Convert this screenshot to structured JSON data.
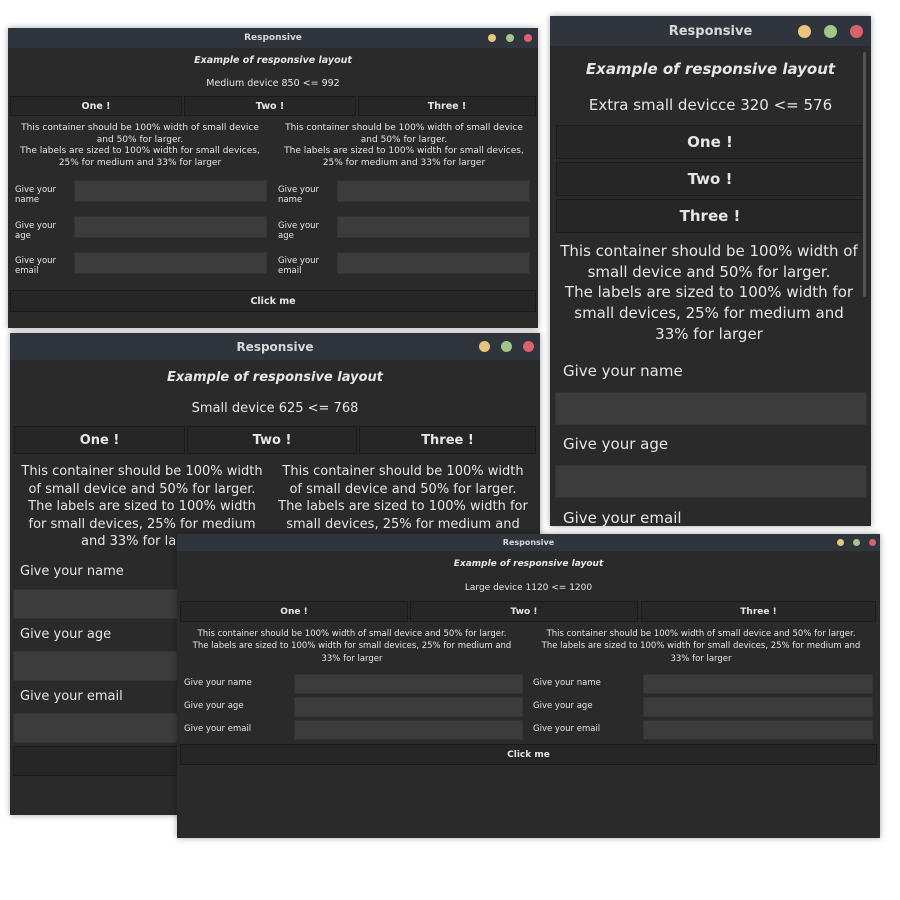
{
  "window_title": "Responsive",
  "heading": "Example of responsive layout",
  "buttons": {
    "one": "One !",
    "two": "Two !",
    "three": "Three !",
    "click": "Click me"
  },
  "container_text": {
    "line1": "This container should be 100% width of small device and 50% for larger.",
    "line2": "The labels are sized to 100% width for small devices, 25% for medium and 33% for larger"
  },
  "fields": {
    "name": "Give your name",
    "age": "Give your age",
    "email": "Give your email"
  },
  "devices": {
    "medium": "Medium device 850 <= 992",
    "extra_small": "Extra small devicce 320 <= 576",
    "small": "Small device 625 <= 768",
    "large": "Large device 1120 <= 1200"
  },
  "window_controls": [
    "minimize-button",
    "maximize-button",
    "close-button"
  ],
  "colors": {
    "yellow": "#e9c47c",
    "green": "#a3c48a",
    "red": "#d9636b",
    "window_bg": "#2a2a2a",
    "titlebar": "#30343d",
    "input": "#3c3c3c"
  }
}
